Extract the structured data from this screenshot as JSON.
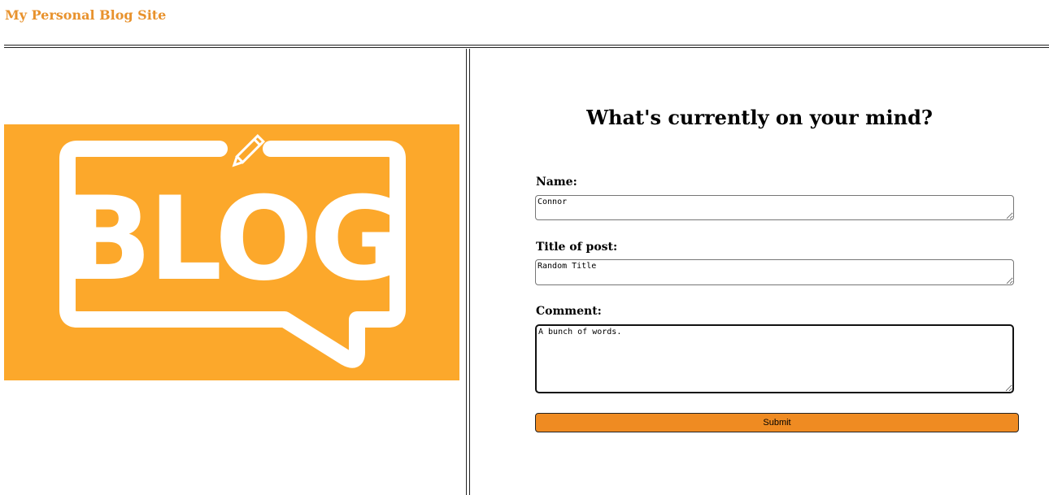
{
  "header": {
    "site_title": "My Personal Blog Site"
  },
  "logo": {
    "icon": "blog-speech-bubble-logo",
    "text": "BLOG",
    "background_color": "#fca82b"
  },
  "form": {
    "heading": "What's currently on your mind?",
    "name_label": "Name:",
    "name_value": "Connor",
    "title_label": "Title of post:",
    "title_value": "Random Title",
    "comment_label": "Comment:",
    "comment_value": "A bunch of words.",
    "submit_label": "Submit"
  },
  "colors": {
    "accent": "#e8922d",
    "button": "#ef8b22"
  }
}
